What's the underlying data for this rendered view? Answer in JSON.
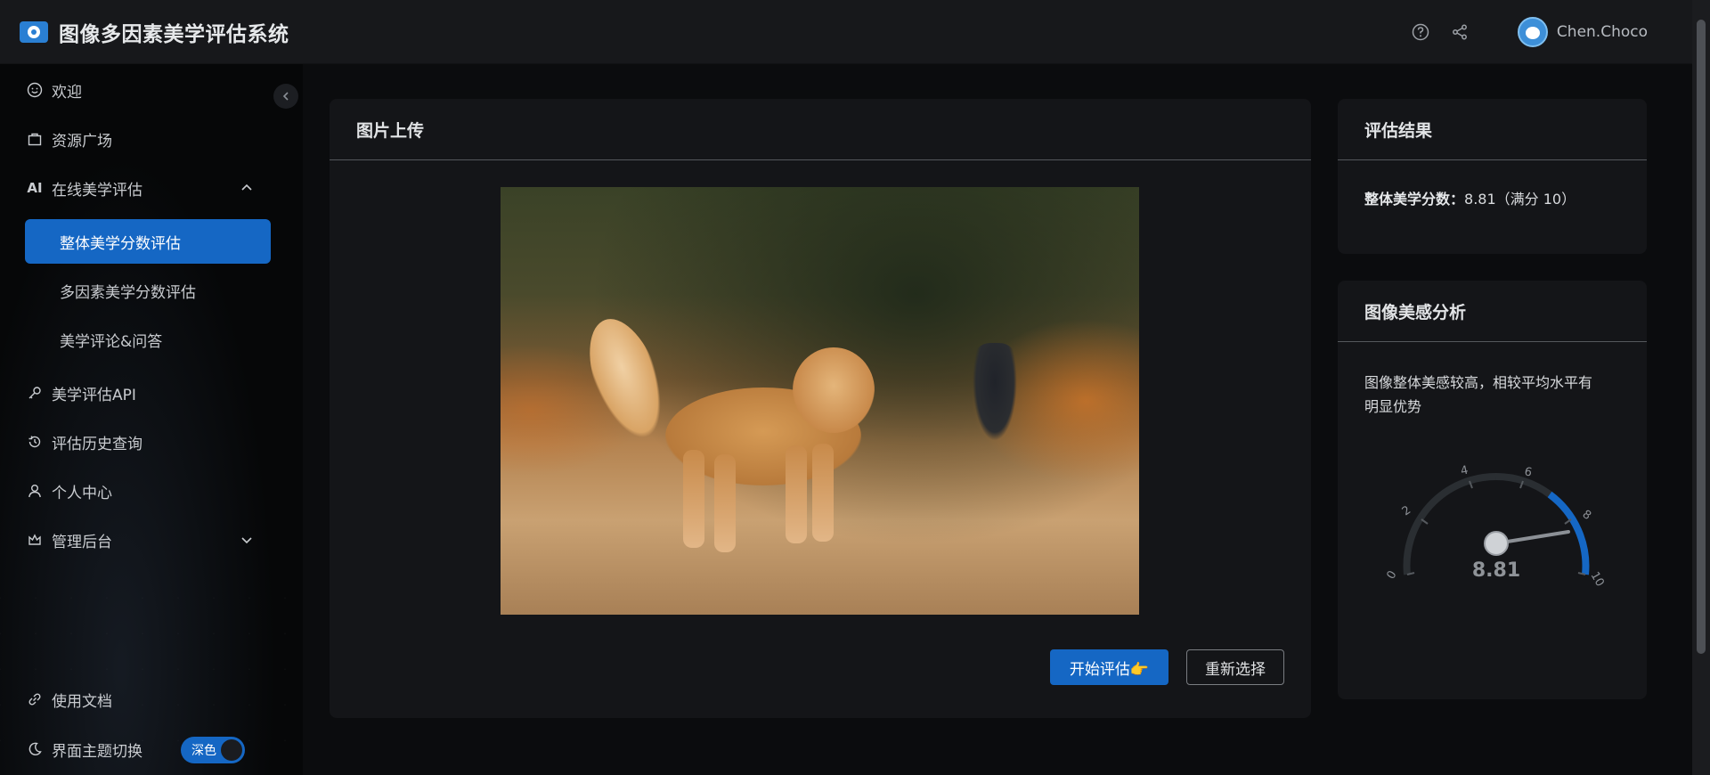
{
  "header": {
    "title": "图像多因素美学评估系统",
    "username": "Chen.Choco"
  },
  "sidebar": {
    "items": [
      {
        "label": "欢迎"
      },
      {
        "label": "资源广场"
      },
      {
        "label": "在线美学评估",
        "prefix": "AI"
      },
      {
        "label": "美学评估API"
      },
      {
        "label": "评估历史查询"
      },
      {
        "label": "个人中心"
      },
      {
        "label": "管理后台"
      }
    ],
    "subitems": [
      {
        "label": "整体美学分数评估"
      },
      {
        "label": "多因素美学分数评估"
      },
      {
        "label": "美学评论&问答"
      }
    ],
    "footer": {
      "docs_label": "使用文档",
      "theme_label": "界面主题切换",
      "theme_value": "深色"
    }
  },
  "upload": {
    "title": "图片上传",
    "start_label": "开始评估👉",
    "reselect_label": "重新选择"
  },
  "result": {
    "title": "评估结果",
    "score_label": "整体美学分数：",
    "score_text": "8.81（满分 10）"
  },
  "analysis": {
    "title": "图像美感分析",
    "text_line1": "图像整体美感较高，相较平均水平有",
    "text_line2": "明显优势",
    "gauge_value": "8.81",
    "gauge_ticks": [
      "0",
      "2",
      "4",
      "6",
      "8",
      "10"
    ]
  },
  "colors": {
    "accent": "#1567c4",
    "background": "#0b0c0e",
    "card": "#141518"
  }
}
